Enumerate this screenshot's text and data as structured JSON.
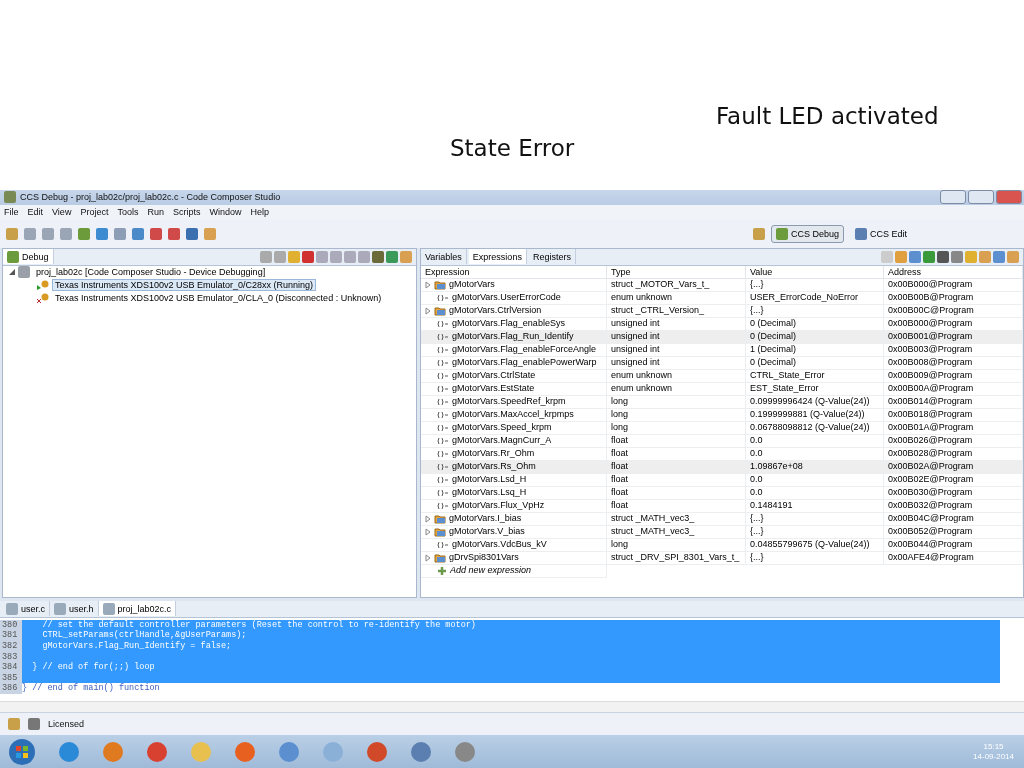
{
  "annotations": [
    {
      "text": "Fault LED activated"
    },
    {
      "text": "State Error"
    }
  ],
  "window": {
    "title": "CCS Debug - proj_lab02c/proj_lab02c.c - Code Composer Studio"
  },
  "menu": [
    "File",
    "Edit",
    "View",
    "Project",
    "Tools",
    "Run",
    "Scripts",
    "Window",
    "Help"
  ],
  "perspectives": [
    {
      "label": "CCS Debug",
      "selected": true
    },
    {
      "label": "CCS Edit",
      "selected": false
    }
  ],
  "debug_panel": {
    "tab": "Debug",
    "tree": [
      {
        "label": "proj_lab02c [Code Composer Studio - Device Debugging]",
        "expanded": true,
        "children": [
          {
            "label": "Texas Instruments XDS100v2 USB Emulator_0/C28xx (Running)",
            "kind": "running",
            "selected": true
          },
          {
            "label": "Texas Instruments XDS100v2 USB Emulator_0/CLA_0 (Disconnected : Unknown)",
            "kind": "disconnected",
            "selected": false
          }
        ]
      }
    ]
  },
  "expressions_panel": {
    "tabs": [
      {
        "label": "Variables",
        "selected": false
      },
      {
        "label": "Expressions",
        "selected": true
      },
      {
        "label": "Registers",
        "selected": false
      }
    ],
    "columns": [
      "Expression",
      "Type",
      "Value",
      "Address"
    ],
    "rows": [
      {
        "kind": "struct",
        "expression": "gMotorVars",
        "type": "struct _MOTOR_Vars_t_",
        "value": "{...}",
        "address": "0x00B000@Program",
        "selected": false
      },
      {
        "kind": "scalar",
        "expression": "gMotorVars.UserErrorCode",
        "type": "enum unknown",
        "value": "USER_ErrorCode_NoError",
        "address": "0x00B00B@Program",
        "selected": false
      },
      {
        "kind": "struct",
        "expression": "gMotorVars.CtrlVersion",
        "type": "struct _CTRL_Version_",
        "value": "{...}",
        "address": "0x00B00C@Program",
        "selected": false
      },
      {
        "kind": "scalar",
        "expression": "gMotorVars.Flag_enableSys",
        "type": "unsigned int",
        "value": "0 (Decimal)",
        "address": "0x00B000@Program",
        "selected": false
      },
      {
        "kind": "scalar",
        "expression": "gMotorVars.Flag_Run_Identify",
        "type": "unsigned int",
        "value": "0 (Decimal)",
        "address": "0x00B001@Program",
        "selected": true
      },
      {
        "kind": "scalar",
        "expression": "gMotorVars.Flag_enableForceAngle",
        "type": "unsigned int",
        "value": "1 (Decimal)",
        "address": "0x00B003@Program",
        "selected": false
      },
      {
        "kind": "scalar",
        "expression": "gMotorVars.Flag_enablePowerWarp",
        "type": "unsigned int",
        "value": "0 (Decimal)",
        "address": "0x00B008@Program",
        "selected": false
      },
      {
        "kind": "scalar",
        "expression": "gMotorVars.CtrlState",
        "type": "enum unknown",
        "value": "CTRL_State_Error",
        "address": "0x00B009@Program",
        "selected": false
      },
      {
        "kind": "scalar",
        "expression": "gMotorVars.EstState",
        "type": "enum unknown",
        "value": "EST_State_Error",
        "address": "0x00B00A@Program",
        "selected": false
      },
      {
        "kind": "scalar",
        "expression": "gMotorVars.SpeedRef_krpm",
        "type": "long",
        "value": "0.09999996424 (Q-Value(24))",
        "address": "0x00B014@Program",
        "selected": false
      },
      {
        "kind": "scalar",
        "expression": "gMotorVars.MaxAccel_krpmps",
        "type": "long",
        "value": "0.1999999881 (Q-Value(24))",
        "address": "0x00B018@Program",
        "selected": false
      },
      {
        "kind": "scalar",
        "expression": "gMotorVars.Speed_krpm",
        "type": "long",
        "value": "0.06788098812 (Q-Value(24))",
        "address": "0x00B01A@Program",
        "selected": false
      },
      {
        "kind": "scalar",
        "expression": "gMotorVars.MagnCurr_A",
        "type": "float",
        "value": "0.0",
        "address": "0x00B026@Program",
        "selected": false
      },
      {
        "kind": "scalar",
        "expression": "gMotorVars.Rr_Ohm",
        "type": "float",
        "value": "0.0",
        "address": "0x00B028@Program",
        "selected": false
      },
      {
        "kind": "scalar",
        "expression": "gMotorVars.Rs_Ohm",
        "type": "float",
        "value": "1.09867e+08",
        "address": "0x00B02A@Program",
        "selected": true
      },
      {
        "kind": "scalar",
        "expression": "gMotorVars.Lsd_H",
        "type": "float",
        "value": "0.0",
        "address": "0x00B02E@Program",
        "selected": false
      },
      {
        "kind": "scalar",
        "expression": "gMotorVars.Lsq_H",
        "type": "float",
        "value": "0.0",
        "address": "0x00B030@Program",
        "selected": false
      },
      {
        "kind": "scalar",
        "expression": "gMotorVars.Flux_VpHz",
        "type": "float",
        "value": "0.1484191",
        "address": "0x00B032@Program",
        "selected": false
      },
      {
        "kind": "struct",
        "expression": "gMotorVars.I_bias",
        "type": "struct _MATH_vec3_",
        "value": "{...}",
        "address": "0x00B04C@Program",
        "selected": false
      },
      {
        "kind": "struct",
        "expression": "gMotorVars.V_bias",
        "type": "struct _MATH_vec3_",
        "value": "{...}",
        "address": "0x00B052@Program",
        "selected": false
      },
      {
        "kind": "scalar",
        "expression": "gMotorVars.VdcBus_kV",
        "type": "long",
        "value": "0.04855799675 (Q-Value(24))",
        "address": "0x00B044@Program",
        "selected": false
      },
      {
        "kind": "struct",
        "expression": "gDrvSpi8301Vars",
        "type": "struct _DRV_SPI_8301_Vars_t_",
        "value": "{...}",
        "address": "0x00AFE4@Program",
        "selected": false
      }
    ],
    "add_expression": "Add new expression"
  },
  "editor": {
    "tabs": [
      {
        "label": "user.c",
        "selected": false
      },
      {
        "label": "user.h",
        "selected": false
      },
      {
        "label": "proj_lab02c.c",
        "selected": true
      }
    ],
    "lines": [
      {
        "number": "380",
        "code": "    // set the default controller parameters (Reset the control to re-identify the motor)",
        "selected": true
      },
      {
        "number": "381",
        "code": "    CTRL_setParams(ctrlHandle,&gUserParams);",
        "selected": true
      },
      {
        "number": "382",
        "code": "    gMotorVars.Flag_Run_Identify = false;",
        "selected": true
      },
      {
        "number": "383",
        "selected": true
      },
      {
        "number": "384",
        "code": "  } // end of for(;;) loop",
        "selected": true
      },
      {
        "number": "385",
        "selected": true
      },
      {
        "number": "386",
        "code": "} // end of main() function",
        "selected": false
      }
    ]
  },
  "status_bar": {
    "text": "Licensed"
  },
  "taskbar": {
    "time": "15:15",
    "date": "14-09-2014"
  }
}
